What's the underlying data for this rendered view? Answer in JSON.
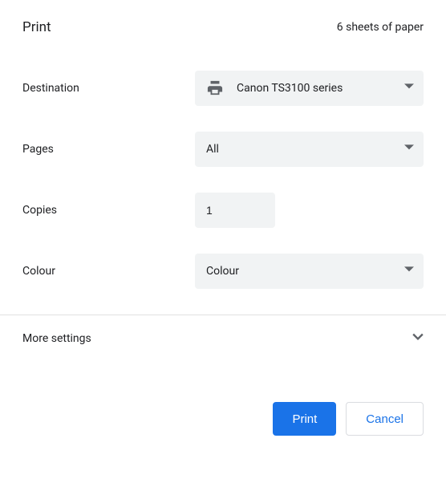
{
  "header": {
    "title": "Print",
    "sheets_text": "6 sheets of paper"
  },
  "form": {
    "destination": {
      "label": "Destination",
      "value": "Canon TS3100 series"
    },
    "pages": {
      "label": "Pages",
      "value": "All"
    },
    "copies": {
      "label": "Copies",
      "value": "1"
    },
    "colour": {
      "label": "Colour",
      "value": "Colour"
    }
  },
  "more_settings": {
    "label": "More settings"
  },
  "buttons": {
    "print": "Print",
    "cancel": "Cancel"
  }
}
